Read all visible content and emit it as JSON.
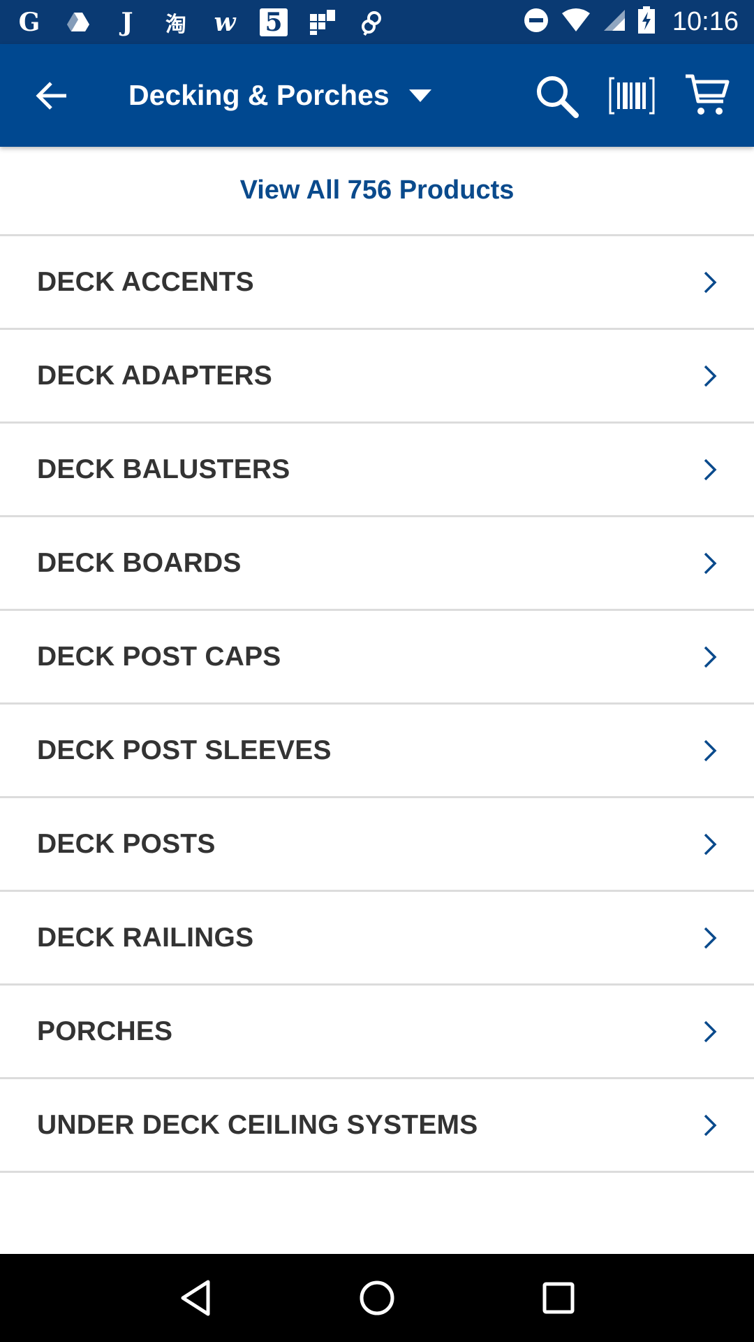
{
  "status_bar": {
    "time": "10:16",
    "left_icons": [
      {
        "name": "google-icon",
        "glyph": "G"
      },
      {
        "name": "drive-icon",
        "glyph": ""
      },
      {
        "name": "j-app-icon",
        "glyph": "J"
      },
      {
        "name": "taobao-icon",
        "glyph": "淘"
      },
      {
        "name": "w-app-icon",
        "glyph": "w"
      },
      {
        "name": "five-app-icon",
        "glyph": "5"
      },
      {
        "name": "grid-app-icon",
        "glyph": ""
      },
      {
        "name": "link-app-icon",
        "glyph": ""
      }
    ]
  },
  "app_bar": {
    "title": "Decking & Porches",
    "background": "#004890"
  },
  "view_all": {
    "label": "View All 756 Products",
    "color": "#0a4a8c"
  },
  "categories": [
    {
      "label": "DECK ACCENTS"
    },
    {
      "label": "DECK ADAPTERS"
    },
    {
      "label": "DECK BALUSTERS"
    },
    {
      "label": "DECK BOARDS"
    },
    {
      "label": "DECK POST CAPS"
    },
    {
      "label": "DECK POST SLEEVES"
    },
    {
      "label": "DECK POSTS"
    },
    {
      "label": "DECK RAILINGS"
    },
    {
      "label": "PORCHES"
    },
    {
      "label": "UNDER DECK CEILING SYSTEMS"
    }
  ],
  "icons": {
    "back": "back-arrow-icon",
    "dropdown": "dropdown-caret-icon",
    "search": "search-icon",
    "barcode": "barcode-icon",
    "cart": "cart-icon",
    "chevron": "chevron-right-icon"
  }
}
